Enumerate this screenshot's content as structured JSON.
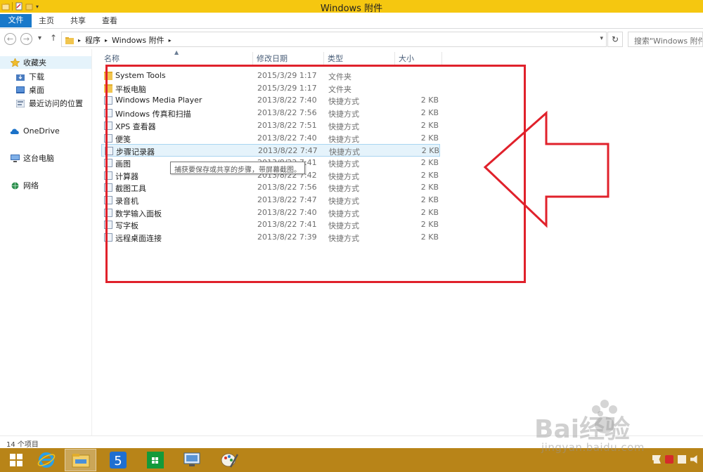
{
  "window": {
    "title": "Windows 附件"
  },
  "ribbon": {
    "tabs": [
      "文件",
      "主页",
      "共享",
      "查看"
    ]
  },
  "address": {
    "crumbs": [
      "程序",
      "Windows 附件"
    ],
    "search_placeholder": "搜索\"Windows 附件\""
  },
  "nav": {
    "items": [
      {
        "label": "收藏夹",
        "icon": "star-icon"
      },
      {
        "label": "下载",
        "icon": "download-folder-icon"
      },
      {
        "label": "桌面",
        "icon": "desktop-icon"
      },
      {
        "label": "最近访问的位置",
        "icon": "recent-places-icon"
      },
      {
        "label": "OneDrive",
        "icon": "onedrive-icon"
      },
      {
        "label": "这台电脑",
        "icon": "computer-icon"
      },
      {
        "label": "网络",
        "icon": "network-icon"
      }
    ]
  },
  "columns": {
    "name": "名称",
    "date": "修改日期",
    "type": "类型",
    "size": "大小"
  },
  "files": [
    {
      "name": "System Tools",
      "date": "2015/3/29 1:17",
      "type": "文件夹",
      "size": ""
    },
    {
      "name": "平板电脑",
      "date": "2015/3/29 1:17",
      "type": "文件夹",
      "size": ""
    },
    {
      "name": "Windows Media Player",
      "date": "2013/8/22 7:40",
      "type": "快捷方式",
      "size": "2 KB"
    },
    {
      "name": "Windows 传真和扫描",
      "date": "2013/8/22 7:56",
      "type": "快捷方式",
      "size": "2 KB"
    },
    {
      "name": "XPS 查看器",
      "date": "2013/8/22 7:51",
      "type": "快捷方式",
      "size": "2 KB"
    },
    {
      "name": "便笺",
      "date": "2013/8/22 7:40",
      "type": "快捷方式",
      "size": "2 KB"
    },
    {
      "name": "步骤记录器",
      "date": "2013/8/22 7:47",
      "type": "快捷方式",
      "size": "2 KB"
    },
    {
      "name": "画图",
      "date": "2013/8/22 7:41",
      "type": "快捷方式",
      "size": "2 KB"
    },
    {
      "name": "计算器",
      "date": "2013/8/22 7:42",
      "type": "快捷方式",
      "size": "2 KB"
    },
    {
      "name": "截图工具",
      "date": "2013/8/22 7:56",
      "type": "快捷方式",
      "size": "2 KB"
    },
    {
      "name": "录音机",
      "date": "2013/8/22 7:47",
      "type": "快捷方式",
      "size": "2 KB"
    },
    {
      "name": "数学输入面板",
      "date": "2013/8/22 7:40",
      "type": "快捷方式",
      "size": "2 KB"
    },
    {
      "name": "写字板",
      "date": "2013/8/22 7:41",
      "type": "快捷方式",
      "size": "2 KB"
    },
    {
      "name": "远程桌面连接",
      "date": "2013/8/22 7:39",
      "type": "快捷方式",
      "size": "2 KB"
    }
  ],
  "tooltip": "捕获要保存或共享的步骤，带屏幕截图。",
  "status": {
    "count": "14 个项目"
  },
  "watermark": {
    "text": "jingyan.baidu.com",
    "logo": "Bai经验"
  },
  "colors": {
    "titlebar": "#f5c710",
    "accent": "#1979ca",
    "annotation": "#e0212b",
    "taskbar": "#b88418"
  }
}
